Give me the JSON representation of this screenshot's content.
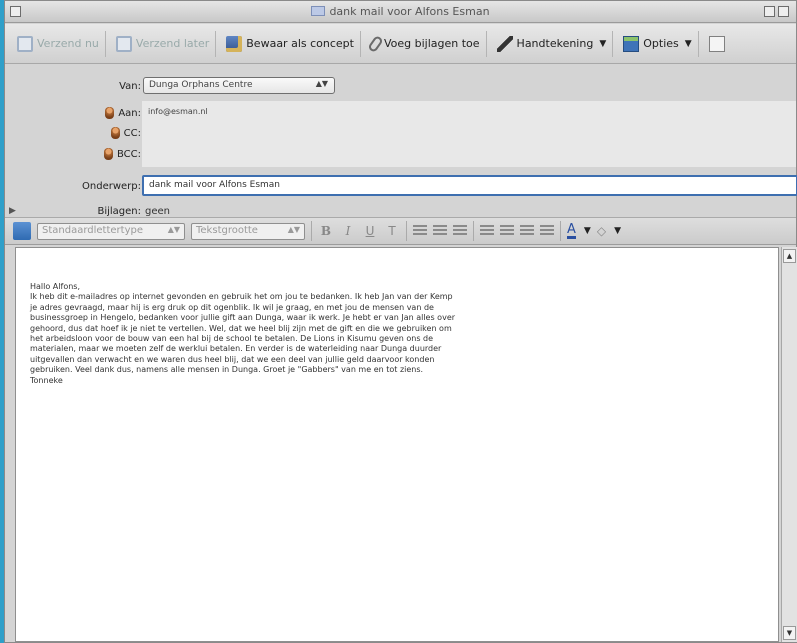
{
  "window": {
    "title": "dank mail voor Alfons Esman"
  },
  "toolbar": {
    "send_now": "Verzend nu",
    "send_later": "Verzend later",
    "save_draft": "Bewaar als concept",
    "attach": "Voeg bijlagen toe",
    "signature": "Handtekening",
    "options": "Opties"
  },
  "fields": {
    "from_label": "Van:",
    "from_value": "Dunga Orphans Centre",
    "to_label": "Aan:",
    "to_value": "info@esman.nl",
    "cc_label": "CC:",
    "bcc_label": "BCC:",
    "subject_label": "Onderwerp:",
    "subject_value": "dank mail voor Alfons Esman",
    "attachments_label": "Bijlagen:",
    "attachments_value": "geen"
  },
  "formatbar": {
    "font_placeholder": "Standaardlettertype",
    "size_placeholder": "Tekstgrootte",
    "bold": "B",
    "italic": "I",
    "underline": "U",
    "teletype": "T"
  },
  "body": {
    "text": "Hallo Alfons,\nIk heb dit e-mailadres op internet gevonden en gebruik het om jou te bedanken. Ik heb Jan van der Kemp\nje adres gevraagd, maar hij is erg druk op dit ogenblik. Ik wil je graag, en met jou de mensen van de\nbusinessgroep in Hengelo, bedanken voor jullie gift aan Dunga, waar ik werk. Je hebt er van Jan alles over\ngehoord, dus dat hoef ik je niet te vertellen. Wel, dat we heel blij zijn met de gift en die we gebruiken om\nhet arbeidsloon voor de bouw van een hal bij de school te betalen. De Lions in Kisumu geven ons de\nmaterialen, maar we moeten zelf de werklui betalen. En verder is de waterleiding naar Dunga duurder\nuitgevallen dan verwacht en we waren dus heel blij, dat we een deel van jullie geld daarvoor konden\ngebruiken. Veel dank dus, namens alle mensen in Dunga. Groet je \"Gabbers\" van me en tot ziens.\nTonneke"
  },
  "colors": {
    "desktop": "#2f9fc9",
    "focus": "#3e6fb0"
  }
}
